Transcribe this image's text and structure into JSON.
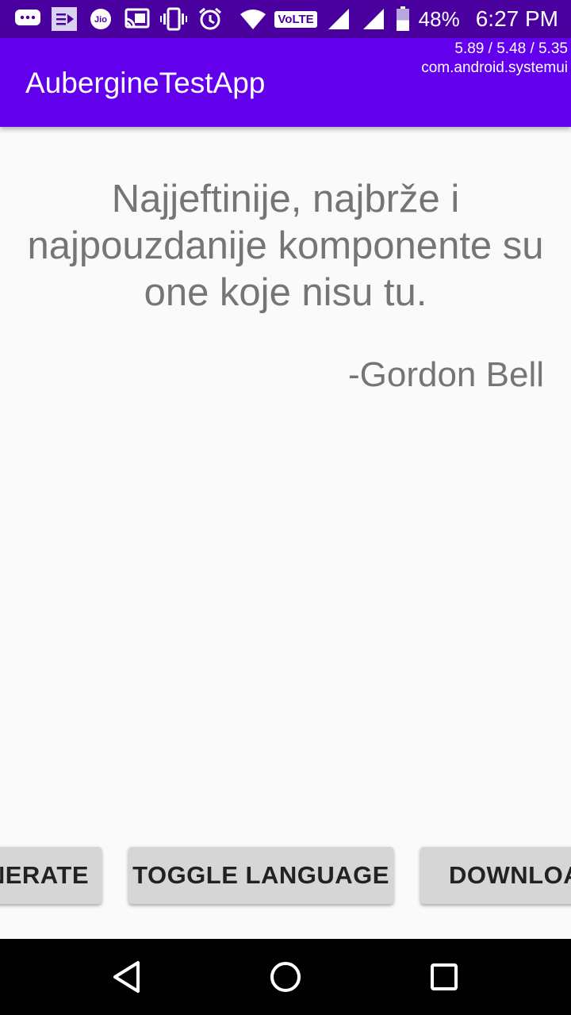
{
  "status_bar": {
    "icons": [
      "chat-bubble-icon",
      "media-notification-icon",
      "jio-icon",
      "cast-icon",
      "vibrate-icon",
      "alarm-icon",
      "wifi-icon",
      "volte-icon",
      "signal-icon",
      "signal-icon",
      "battery-icon"
    ],
    "jio_label": "Jio",
    "volte_label": "VoLTE",
    "battery_percent": "48%",
    "battery_level": 0.48,
    "time": "6:27 PM"
  },
  "overlay": {
    "load": "5.89 / 5.48 / 5.35",
    "process": "com.android.systemui"
  },
  "app_bar": {
    "title": "AubergineTestApp",
    "color": "#6200ee"
  },
  "quote": {
    "text": "Najjeftinije, najbrže i najpouzdanije komponente su one koje nisu tu.",
    "author": "-Gordon Bell"
  },
  "buttons": {
    "generate": "NERATE",
    "toggle_language": "TOGGLE LANGUAGE",
    "download": "DOWNLOA"
  },
  "nav_bar": {
    "icons": [
      "back-icon",
      "home-icon",
      "recents-icon"
    ]
  }
}
